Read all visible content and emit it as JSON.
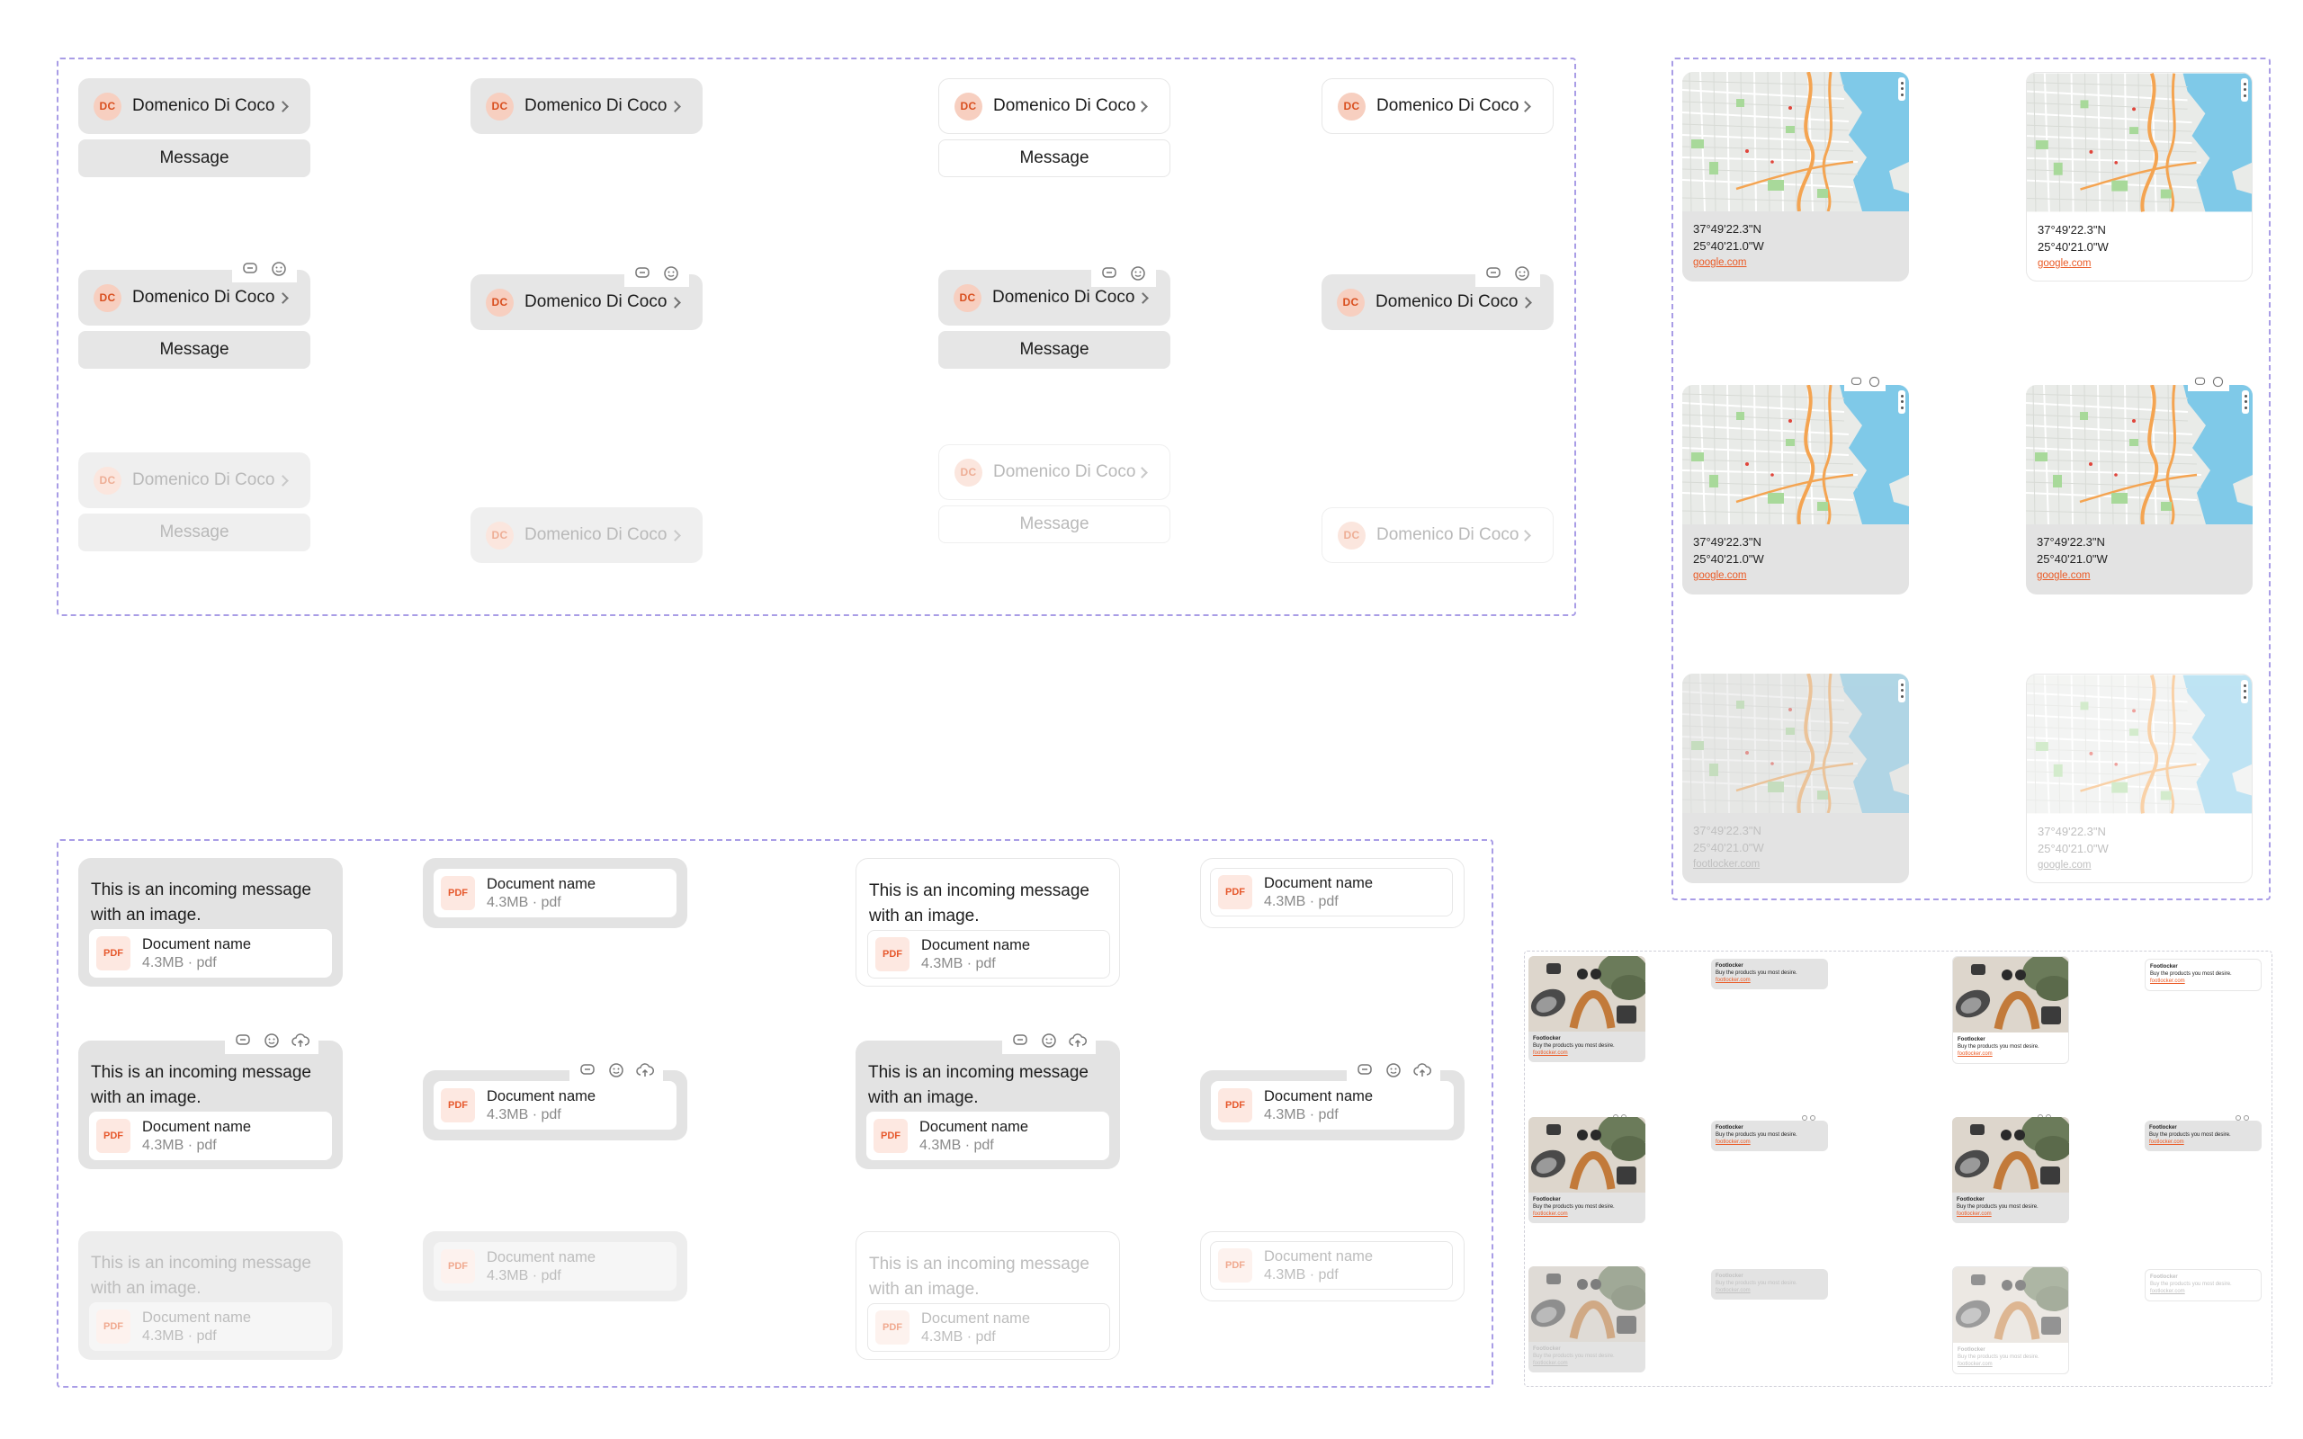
{
  "contact": {
    "initials": "DC",
    "name": "Domenico Di Coco",
    "message_label": "Message"
  },
  "location": {
    "lat": "37°49'22.3\"N",
    "lng": "25°40'21.0\"W",
    "link": "google.com",
    "link_alt": "footlocker.com"
  },
  "message": {
    "text": "This is an incoming message with an image.",
    "doc_name": "Document name",
    "doc_meta": "4.3MB · pdf",
    "doc_badge": "PDF"
  },
  "link_preview": {
    "title": "Footlocker",
    "desc": "Buy the products you most desire.",
    "url": "footlocker.com"
  },
  "actions": [
    "reply-icon",
    "emoji-icon",
    "cloud-upload-icon"
  ],
  "colors": {
    "accent": "#ea5a25",
    "frame_border": "#a99de6",
    "card_gray": "#e3e3e3",
    "avatar_bg": "#f7cfc0"
  }
}
